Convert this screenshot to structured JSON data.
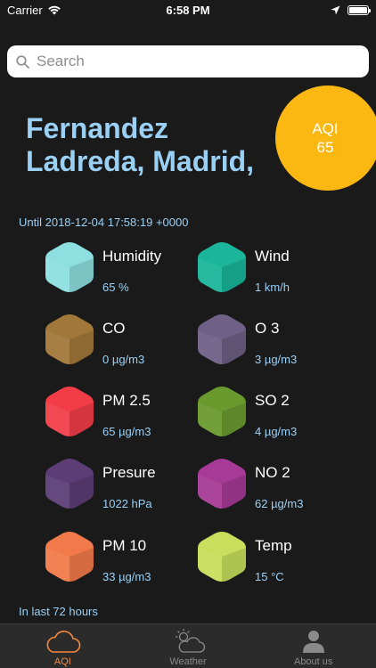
{
  "status_bar": {
    "carrier": "Carrier",
    "time": "6:58 PM"
  },
  "search": {
    "placeholder": "Search"
  },
  "aqi": {
    "label": "AQI",
    "value": "65",
    "color": "#fbb812"
  },
  "city": "Fernandez Ladreda, Madrid,",
  "until": "Until 2018-12-04 17:58:19 +0000",
  "metrics": [
    {
      "label": "Humidity",
      "value": "65 %",
      "color": "#8ee0e0"
    },
    {
      "label": "Wind",
      "value": "1 km/h",
      "color": "#1ab59a"
    },
    {
      "label": "CO",
      "value": "0 µg/m3",
      "color": "#a2783a"
    },
    {
      "label": "O 3",
      "value": "3 µg/m3",
      "color": "#6e6086"
    },
    {
      "label": "PM 2.5",
      "value": "65 µg/m3",
      "color": "#f23d47"
    },
    {
      "label": "SO 2",
      "value": "4 µg/m3",
      "color": "#6a9a2e"
    },
    {
      "label": "Presure",
      "value": "1022 hPa",
      "color": "#5c3d75"
    },
    {
      "label": "NO 2",
      "value": "62 µg/m3",
      "color": "#a63a96"
    },
    {
      "label": "PM 10",
      "value": "33 µg/m3",
      "color": "#f27a4a"
    },
    {
      "label": "Temp",
      "value": "15 °C",
      "color": "#c8de5c"
    }
  ],
  "last72": "In last 72 hours",
  "tabs": [
    {
      "label": "AQI",
      "icon": "cloud-icon",
      "active": true
    },
    {
      "label": "Weather",
      "icon": "weather-icon",
      "active": false
    },
    {
      "label": "About us",
      "icon": "person-icon",
      "active": false
    }
  ]
}
